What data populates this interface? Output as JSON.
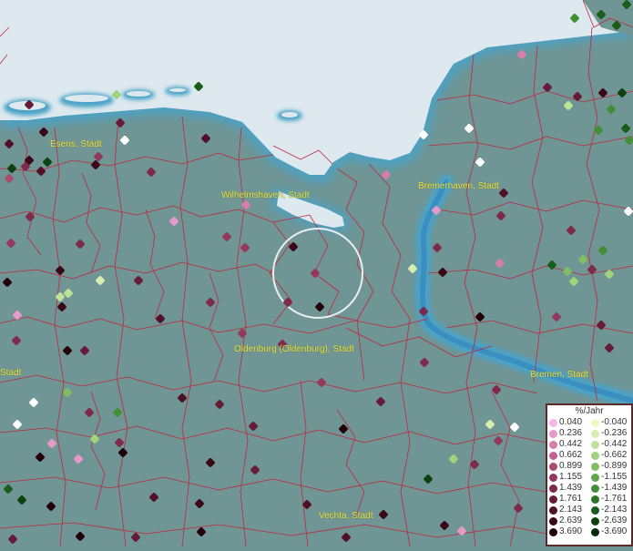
{
  "map": {
    "cities": [
      {
        "id": "esens",
        "label": "Esens, Stadt"
      },
      {
        "id": "wilhelmshaven",
        "label": "Wilhelmshaven, Stadt"
      },
      {
        "id": "bremerhaven",
        "label": "Bremerhaven, Stadt"
      },
      {
        "id": "oldenburg",
        "label": "Oldenburg (Oldenburg), Stadt"
      },
      {
        "id": "bremen",
        "label": "Bremen, Stadt"
      },
      {
        "id": "vechta",
        "label": "Vechta, Stadt"
      },
      {
        "id": "left-stadt",
        "label": "Stadt"
      }
    ],
    "colors": {
      "sea": "#dde9ee",
      "land": "#6f9595",
      "coast_glow": "#4aa3c8",
      "river": "#3b8fc0",
      "borders": "#c0283a",
      "selection_circle": "#ffffff",
      "city_label": "#e8e83a"
    }
  },
  "legend": {
    "title": "%/Jahr",
    "positive": [
      {
        "label": "0.040",
        "color": "#f7b6e6"
      },
      {
        "label": "0.236",
        "color": "#e59ac8"
      },
      {
        "label": "0.442",
        "color": "#d67eaa"
      },
      {
        "label": "0.662",
        "color": "#c2638e"
      },
      {
        "label": "0.899",
        "color": "#a94d72"
      },
      {
        "label": "1.155",
        "color": "#93395d"
      },
      {
        "label": "1.439",
        "color": "#7d2a4b"
      },
      {
        "label": "1.761",
        "color": "#661c38"
      },
      {
        "label": "2.143",
        "color": "#501126"
      },
      {
        "label": "2.639",
        "color": "#3a0817"
      },
      {
        "label": "3.690",
        "color": "#22000a"
      }
    ],
    "negative": [
      {
        "label": "-0.040",
        "color": "#f2f7c4"
      },
      {
        "label": "-0.236",
        "color": "#d8eeb0"
      },
      {
        "label": "-0.442",
        "color": "#bde39a"
      },
      {
        "label": "-0.662",
        "color": "#9fd37d"
      },
      {
        "label": "-0.899",
        "color": "#7fbf61"
      },
      {
        "label": "-1.155",
        "color": "#5fa84a"
      },
      {
        "label": "-1.439",
        "color": "#438f37"
      },
      {
        "label": "-1.761",
        "color": "#2b7627"
      },
      {
        "label": "-2.143",
        "color": "#185d1a"
      },
      {
        "label": "-2.639",
        "color": "#0a4310"
      },
      {
        "label": "-3.690",
        "color": "#012a06"
      }
    ]
  }
}
